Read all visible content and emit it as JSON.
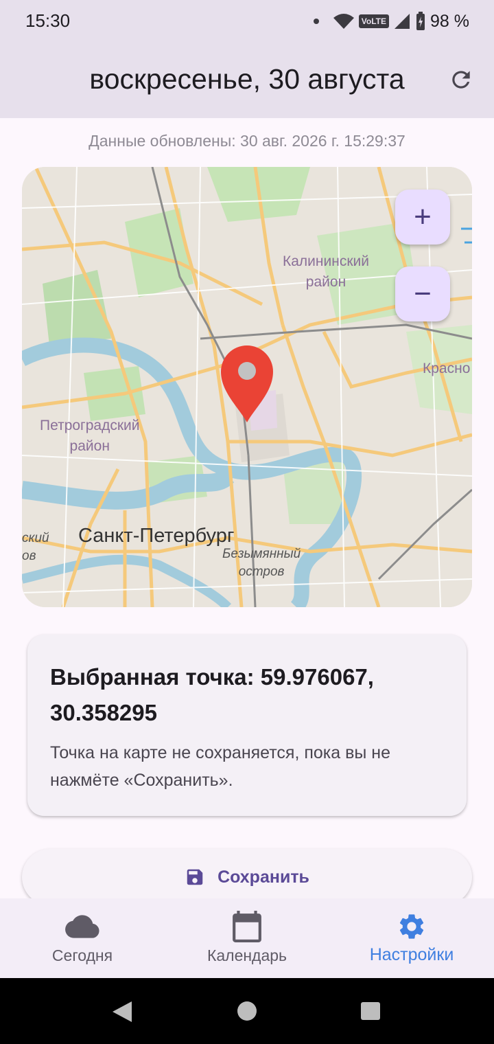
{
  "status": {
    "time": "15:30",
    "network": "VoLTE",
    "battery": "98 %"
  },
  "appbar": {
    "title": "воскресенье, 30 августа"
  },
  "updated_text": "Данные обновлены: 30 авг. 2026 г. 15:29:37",
  "map": {
    "labels": {
      "kalininsky": "Калининский\nрайон",
      "petrogradsky": "Петроградский\nрайон",
      "spb": "Санкт-Петербург",
      "bezymyanny": "Безымянный\nостров",
      "krasno": "Красно",
      "left_fragment": "ский\nов"
    },
    "zoom_in": "+",
    "zoom_out": "−",
    "colors": {
      "road": "#f6c872",
      "water": "#9dc8d6",
      "park": "#b5dca5",
      "pin": "#ea4335"
    }
  },
  "card": {
    "title": "Выбранная точка: 59.976067, 30.358295",
    "note": "Точка на карте не сохраняется, пока вы не нажмёте «Сохранить»."
  },
  "save_button": {
    "label": "Сохранить"
  },
  "nav": [
    {
      "label": "Сегодня",
      "icon": "cloud-icon"
    },
    {
      "label": "Календарь",
      "icon": "calendar-icon"
    },
    {
      "label": "Настройки",
      "icon": "gear-icon",
      "active": true
    }
  ]
}
